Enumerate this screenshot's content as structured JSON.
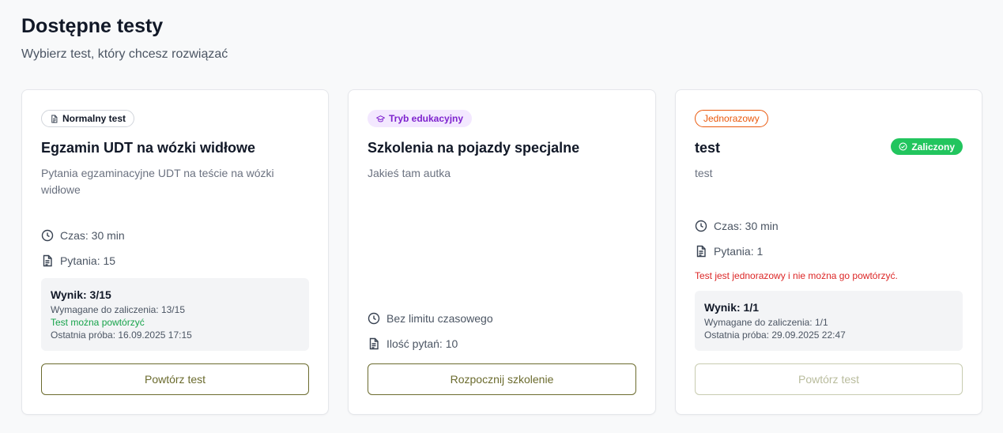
{
  "header": {
    "title": "Dostępne testy",
    "subtitle": "Wybierz test, który chcesz rozwiązać"
  },
  "colors": {
    "accent": "#6b6b2e",
    "success": "#22c55e",
    "danger": "#dc2626",
    "edu_badge": "#7e22ce",
    "once_badge": "#ea580c"
  },
  "cards": [
    {
      "badge": "Normalny test",
      "badge_icon": "document-icon",
      "title": "Egzamin UDT na wózki widłowe",
      "description": "Pytania egzaminacyjne UDT na teście na wózki widłowe",
      "time": "Czas: 30 min",
      "questions": "Pytania: 15",
      "result": {
        "score": "Wynik: 3/15",
        "required": "Wymagane do zaliczenia: 13/15",
        "retake": "Test można powtórzyć",
        "last_attempt": "Ostatnia próba: 16.09.2025 17:15"
      },
      "button": "Powtórz test"
    },
    {
      "badge": "Tryb edukacyjny",
      "badge_icon": "graduation-cap-icon",
      "title": "Szkolenia na pojazdy specjalne",
      "description": "Jakieś tam autka",
      "time": "Bez limitu czasowego",
      "questions": "Ilość pytań: 10",
      "button": "Rozpocznij szkolenie"
    },
    {
      "badge": "Jednorazowy",
      "status": "Zaliczony",
      "status_icon": "check-circle-icon",
      "title": "test",
      "description": "test",
      "time": "Czas: 30 min",
      "questions": "Pytania: 1",
      "warning": "Test jest jednorazowy i nie można go powtórzyć.",
      "result": {
        "score": "Wynik: 1/1",
        "required": "Wymagane do zaliczenia: 1/1",
        "last_attempt": "Ostatnia próba: 29.09.2025 22:47"
      },
      "button": "Powtórz test",
      "button_disabled": true
    }
  ]
}
